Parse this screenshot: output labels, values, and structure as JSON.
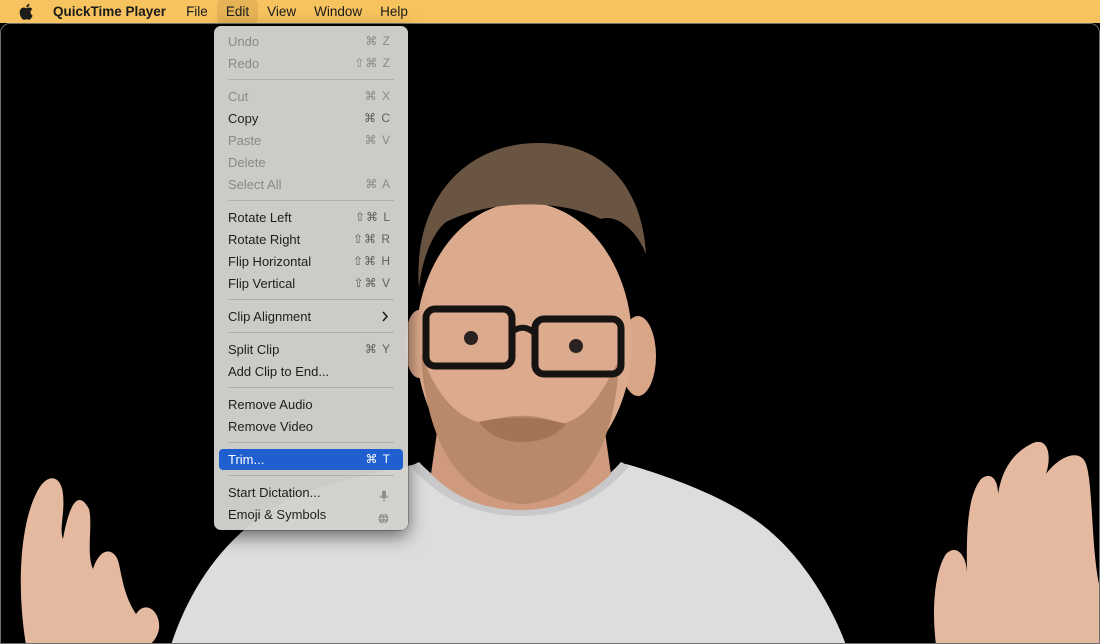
{
  "menubar": {
    "apple_icon": "apple-logo-icon",
    "app_name": "QuickTime Player",
    "items": [
      "File",
      "Edit",
      "View",
      "Window",
      "Help"
    ],
    "active_item": "Edit",
    "background": "#f6c35e"
  },
  "edit_menu": {
    "undo": {
      "label": "Undo",
      "shortcut": "⌘ Z",
      "enabled": false
    },
    "redo": {
      "label": "Redo",
      "shortcut": "⇧⌘ Z",
      "enabled": false
    },
    "cut": {
      "label": "Cut",
      "shortcut": "⌘ X",
      "enabled": false
    },
    "copy": {
      "label": "Copy",
      "shortcut": "⌘ C",
      "enabled": true
    },
    "paste": {
      "label": "Paste",
      "shortcut": "⌘ V",
      "enabled": false
    },
    "delete": {
      "label": "Delete",
      "enabled": false
    },
    "select_all": {
      "label": "Select All",
      "shortcut": "⌘ A",
      "enabled": false
    },
    "rotate_left": {
      "label": "Rotate Left",
      "shortcut": "⇧⌘ L",
      "enabled": true
    },
    "rotate_right": {
      "label": "Rotate Right",
      "shortcut": "⇧⌘ R",
      "enabled": true
    },
    "flip_horizontal": {
      "label": "Flip Horizontal",
      "shortcut": "⇧⌘ H",
      "enabled": true
    },
    "flip_vertical": {
      "label": "Flip Vertical",
      "shortcut": "⇧⌘ V",
      "enabled": true
    },
    "clip_alignment": {
      "label": "Clip Alignment",
      "submenu": true,
      "icon": "chevron-right-icon",
      "enabled": true
    },
    "split_clip": {
      "label": "Split Clip",
      "shortcut": "⌘ Y",
      "enabled": true
    },
    "add_clip_to_end": {
      "label": "Add Clip to End...",
      "enabled": true
    },
    "remove_audio": {
      "label": "Remove Audio",
      "enabled": true
    },
    "remove_video": {
      "label": "Remove Video",
      "enabled": true
    },
    "trim": {
      "label": "Trim...",
      "shortcut": "⌘ T",
      "enabled": true,
      "highlighted": true
    },
    "start_dictation": {
      "label": "Start Dictation...",
      "icon": "microphone-icon",
      "enabled": true
    },
    "emoji_symbols": {
      "label": "Emoji & Symbols",
      "icon": "globe-icon",
      "enabled": true
    },
    "highlight_color": "#1f5fd0"
  },
  "video": {
    "background": "#000000",
    "subject": "bearded-man-with-glasses-shrugging"
  }
}
